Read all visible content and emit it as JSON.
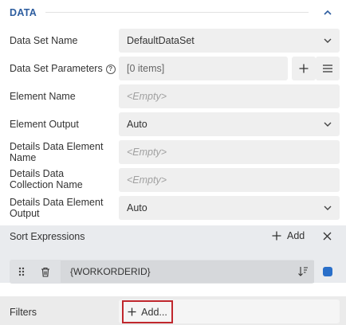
{
  "section": {
    "title": "DATA",
    "collapse_icon": "chevron-up-icon"
  },
  "rows": {
    "data_set_name": {
      "label": "Data Set Name",
      "value": "DefaultDataSet"
    },
    "data_set_parameters": {
      "label": "Data Set Parameters",
      "value": "[0 items]",
      "help_icon": "?"
    },
    "element_name": {
      "label": "Element Name",
      "placeholder": "<Empty>"
    },
    "element_output": {
      "label": "Element Output",
      "value": "Auto"
    },
    "details_data_element_name": {
      "label_line1": "Details Data Element",
      "label_line2": "Name",
      "placeholder": "<Empty>"
    },
    "details_data_collection_name": {
      "label_line1": "Details Data",
      "label_line2": "Collection Name",
      "placeholder": "<Empty>"
    },
    "details_data_element_output": {
      "label_line1": "Details Data Element",
      "label_line2": "Output",
      "value": "Auto"
    }
  },
  "sort": {
    "label": "Sort Expressions",
    "add_label": "Add",
    "item": {
      "expression": "{WORKORDERID}"
    }
  },
  "filters": {
    "label": "Filters",
    "add_label": "Add..."
  },
  "colors": {
    "accent": "#2d5d9f",
    "highlight_border": "#c0272d",
    "sort_indicator": "#2a6fc9"
  }
}
